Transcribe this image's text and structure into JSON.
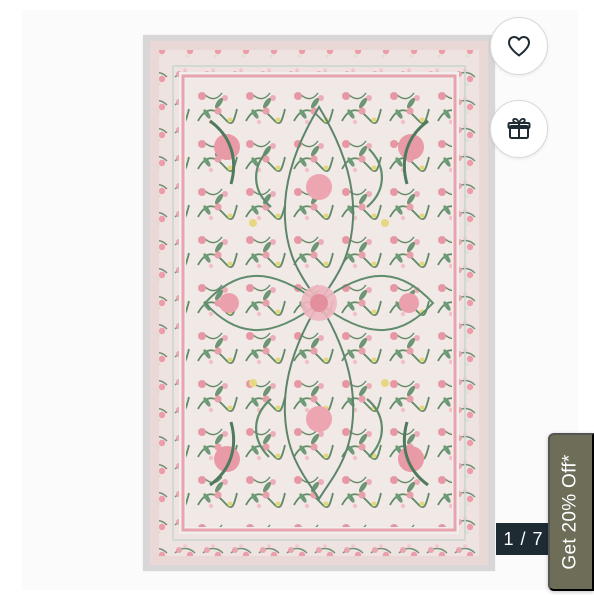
{
  "actions": {
    "favorite_icon": "heart-icon",
    "gift_icon": "gift-icon"
  },
  "gallery": {
    "counter": "1 / 7"
  },
  "promo": {
    "tab_label": "Get 20% Off*"
  },
  "colors": {
    "rug_field": "#f0e9e6",
    "rug_border": "#ead8d6",
    "pink": "#e7a0aa",
    "green": "#4e7a5d",
    "yellow": "#e8d784",
    "counter_background": "#1f2b33",
    "promo_background": "#6e6d58"
  }
}
